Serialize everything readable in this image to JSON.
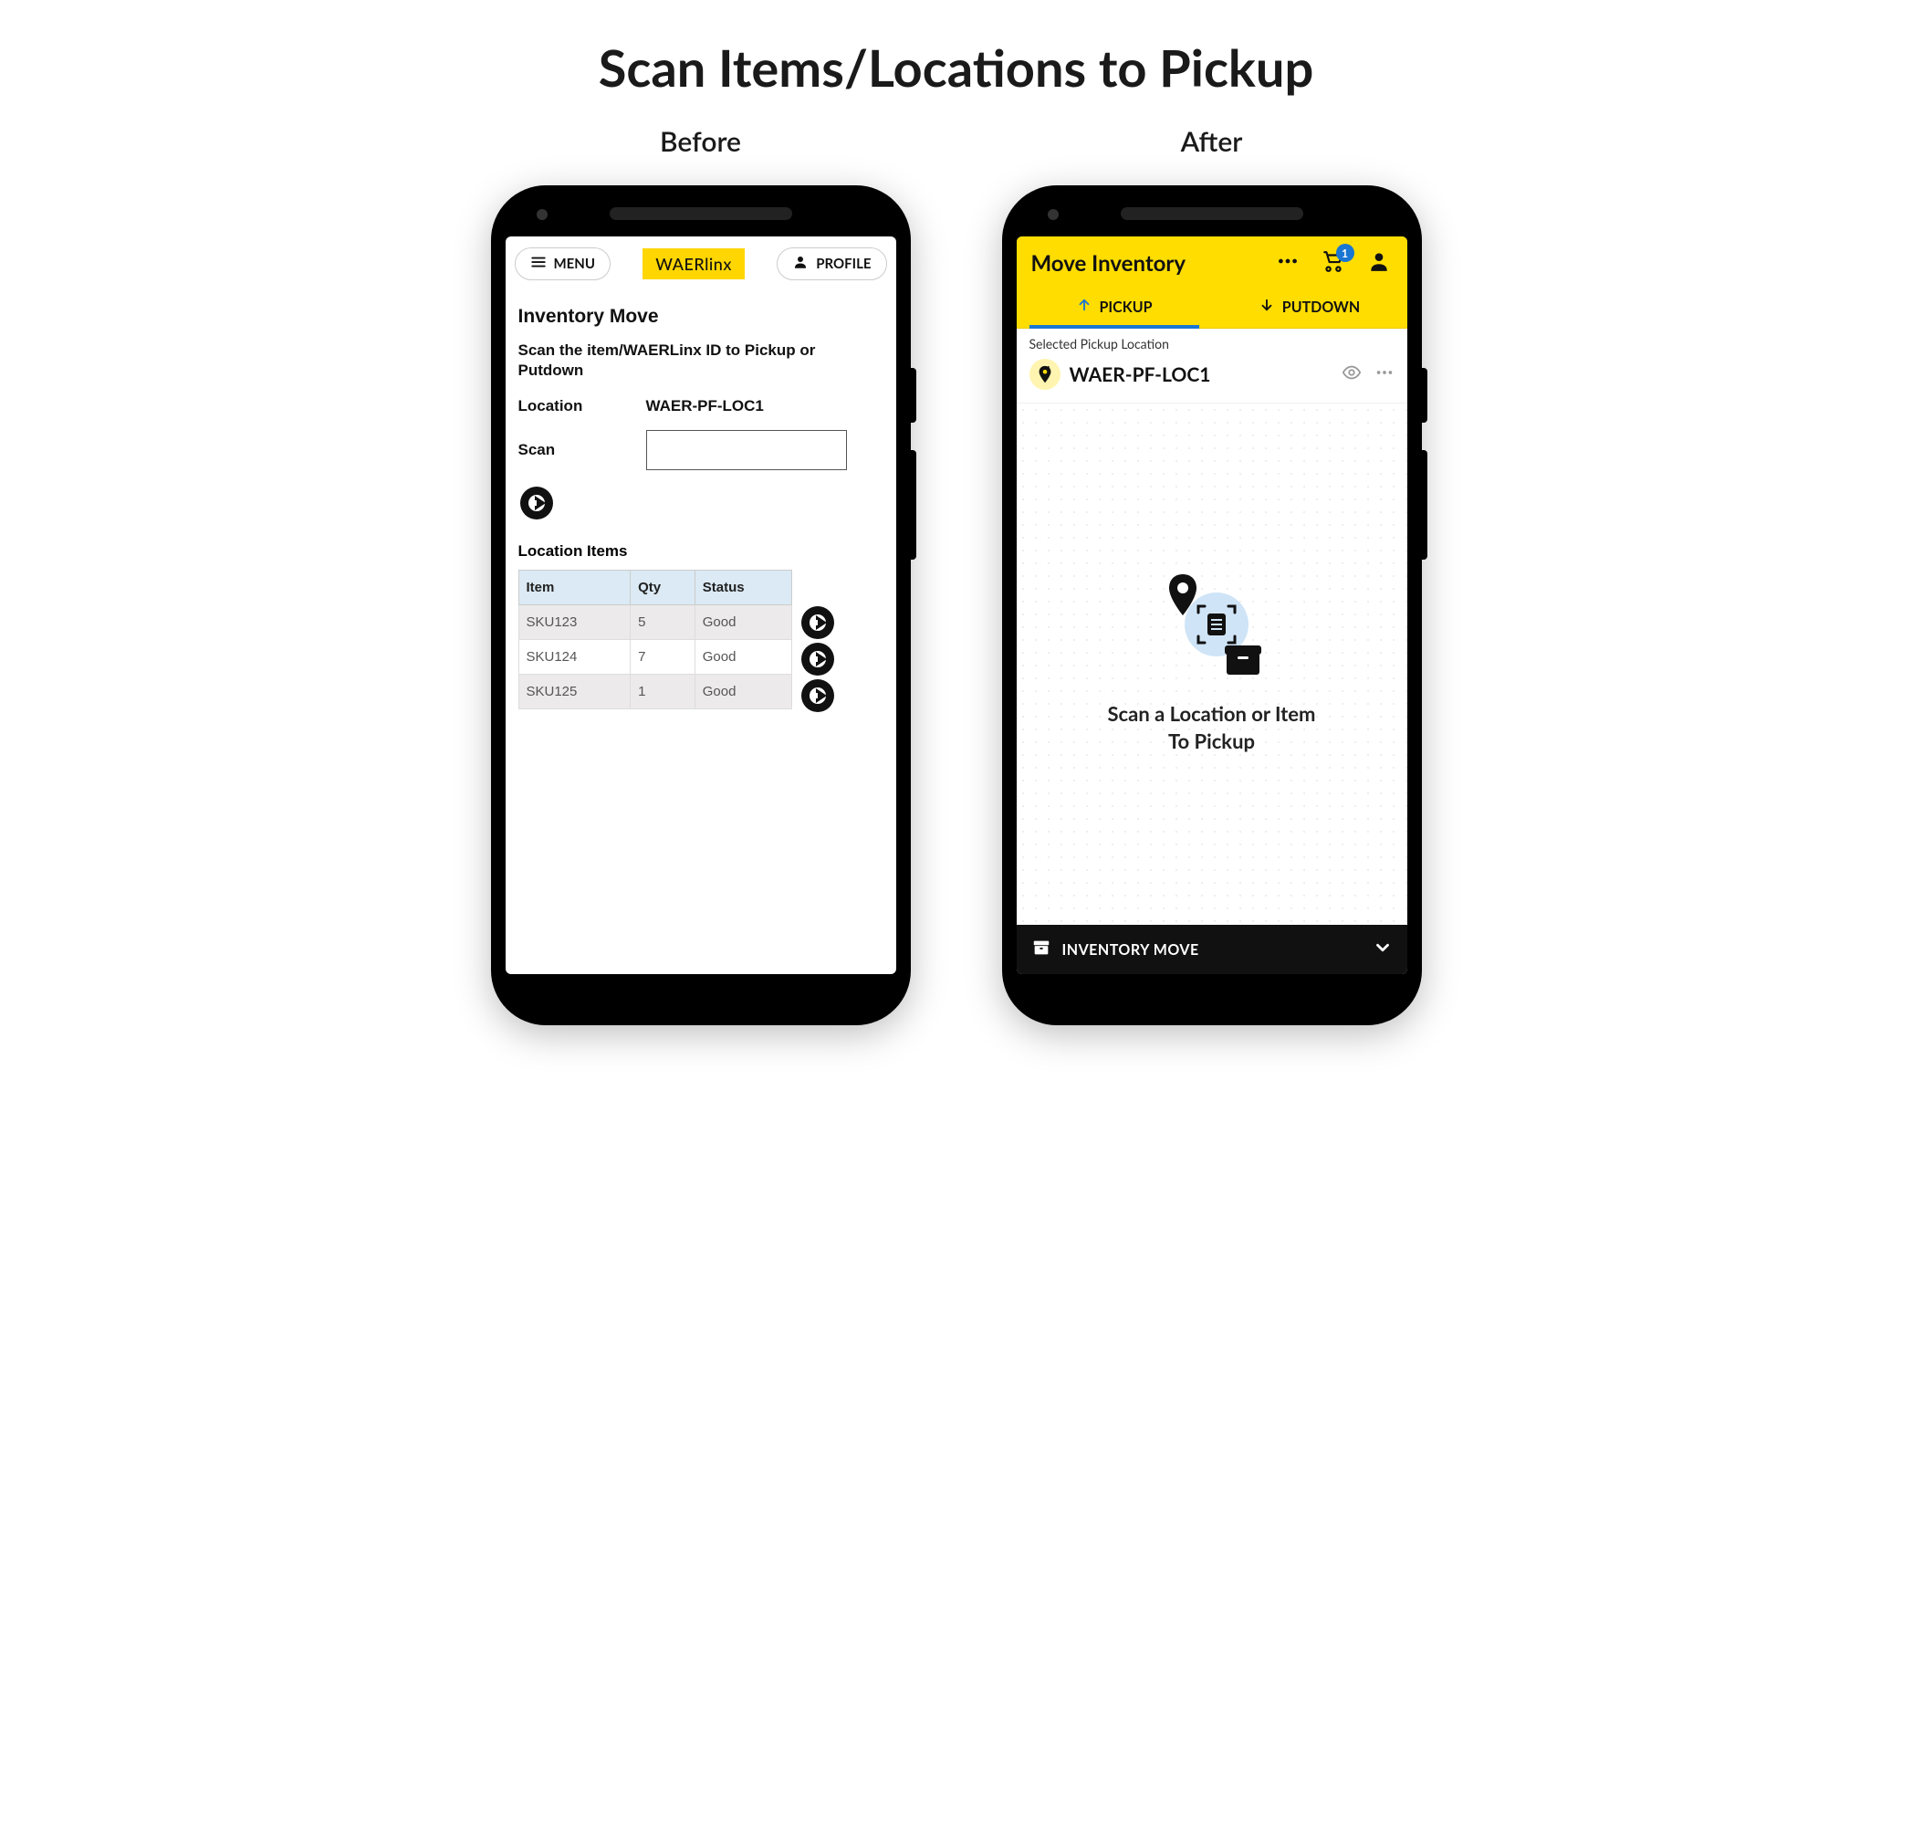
{
  "page_title": "Scan Items/Locations to Pickup",
  "before_label": "Before",
  "after_label": "After",
  "before": {
    "menu_label": "MENU",
    "logo": "WAERlinx",
    "profile_label": "PROFILE",
    "screen_title": "Inventory Move",
    "instruction": "Scan the item/WAERLinx ID to Pickup or Putdown",
    "location_label": "Location",
    "location_value": "WAER-PF-LOC1",
    "scan_label": "Scan",
    "section_title": "Location Items",
    "table": {
      "headers": {
        "item": "Item",
        "qty": "Qty",
        "status": "Status"
      },
      "rows": [
        {
          "item": "SKU123",
          "qty": "5",
          "status": "Good"
        },
        {
          "item": "SKU124",
          "qty": "7",
          "status": "Good"
        },
        {
          "item": "SKU125",
          "qty": "1",
          "status": "Good"
        }
      ]
    }
  },
  "after": {
    "title": "Move Inventory",
    "cart_count": "1",
    "tabs": {
      "pickup": "PICKUP",
      "putdown": "PUTDOWN"
    },
    "selected_label": "Selected Pickup Location",
    "location_value": "WAER-PF-LOC1",
    "hero_line1": "Scan a Location or Item",
    "hero_line2": "To Pickup",
    "bottom_label": "INVENTORY MOVE"
  }
}
